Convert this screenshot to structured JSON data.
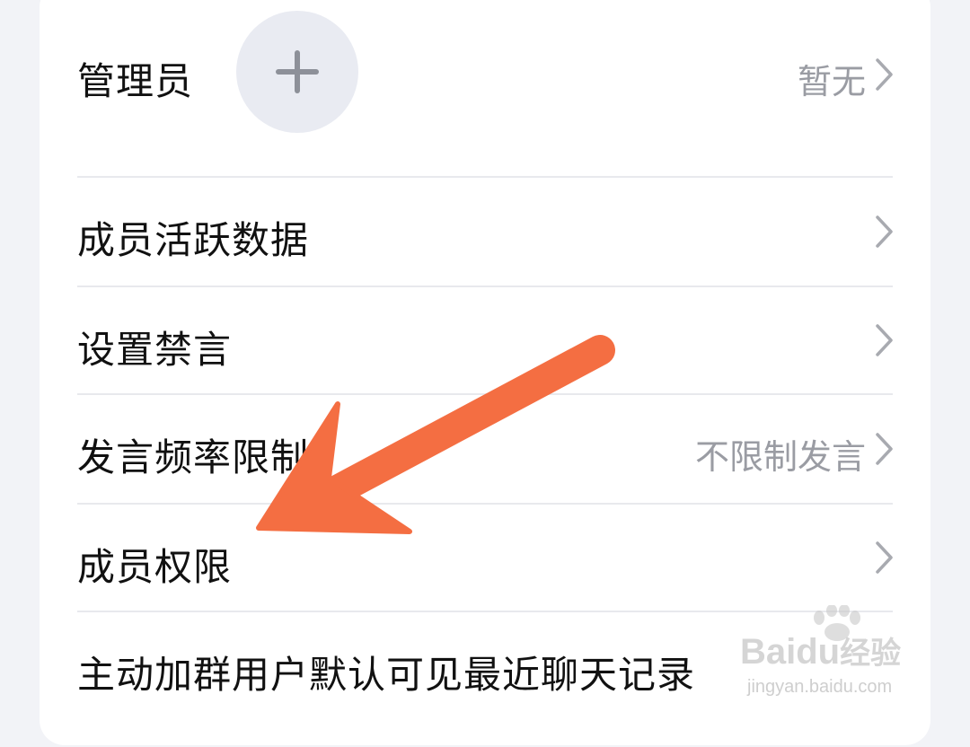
{
  "settings": {
    "admin": {
      "label": "管理员",
      "value": "暂无"
    },
    "activity": {
      "label": "成员活跃数据"
    },
    "mute": {
      "label": "设置禁言"
    },
    "frequency": {
      "label": "发言频率限制",
      "value": "不限制发言"
    },
    "permissions": {
      "label": "成员权限"
    },
    "history": {
      "label": "主动加群用户默认可见最近聊天记录"
    }
  },
  "watermark": {
    "brand": "Baidu",
    "brand_cn": "经验",
    "url": "jingyan.baidu.com"
  },
  "colors": {
    "accent_arrow": "#f46e42",
    "text": "#111111",
    "muted": "#9a9ca3",
    "divider": "#e8e9ed"
  },
  "icons": [
    "plus-icon",
    "chevron-right-icon",
    "annotation-arrow",
    "baidu-paw-logo"
  ]
}
